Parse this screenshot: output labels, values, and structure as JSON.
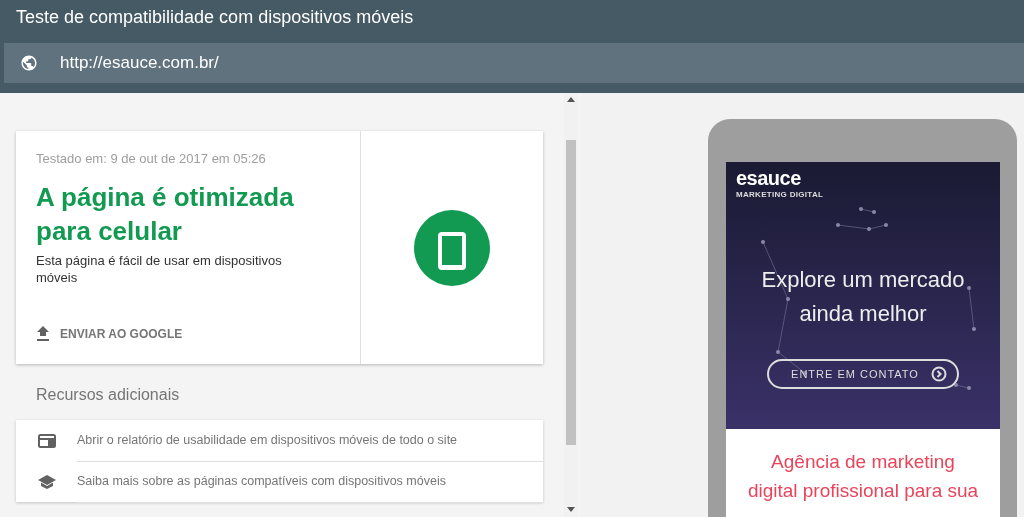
{
  "header": {
    "title": "Teste de compatibilidade com dispositivos móveis",
    "url": "http://esauce.com.br/"
  },
  "result": {
    "tested_at": "Testado em: 9 de out de 2017 em 05:26",
    "heading": "A página é otimizada para celular",
    "description": "Esta página é fácil de usar em dispositivos móveis",
    "action": "ENVIAR AO GOOGLE"
  },
  "resources": {
    "title": "Recursos adicionais",
    "items": [
      {
        "kind": "report",
        "label": "Abrir o relatório de usabilidade em dispositivos móveis de todo o site"
      },
      {
        "kind": "learn",
        "label": "Saiba mais sobre as páginas compatíveis com dispositivos móveis"
      }
    ]
  },
  "preview": {
    "logo": "esauce",
    "logo_tagline": "MARKETING DIGITAL",
    "hero_title": "Explore um mercado ainda melhor",
    "cta": "ENTRE EM CONTATO",
    "section_title": "Agência de marketing digital profissional para sua"
  }
}
